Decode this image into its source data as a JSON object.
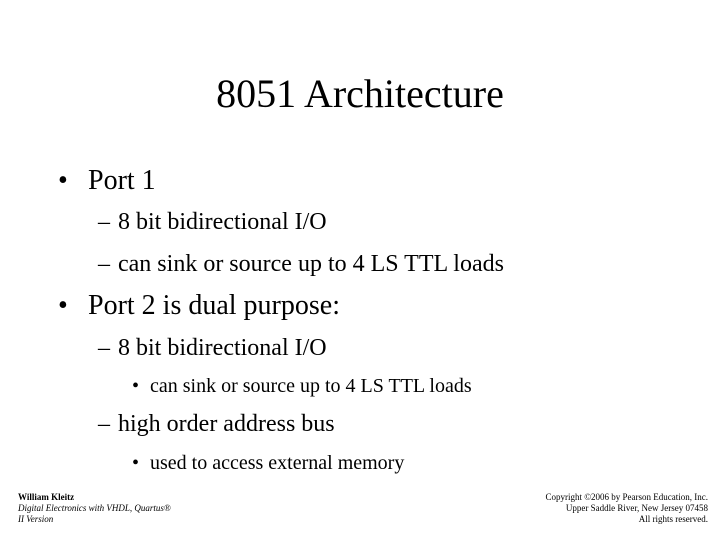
{
  "slide": {
    "title": "8051 Architecture",
    "bullets": [
      {
        "marker": "•",
        "text": "Port 1"
      },
      {
        "marker": "–",
        "text": "8 bit bidirectional I/O"
      },
      {
        "marker": "–",
        "text": "can sink or source up to 4 LS TTL loads"
      },
      {
        "marker": "•",
        "text": "Port 2 is dual purpose:"
      },
      {
        "marker": "–",
        "text": "8 bit bidirectional I/O"
      },
      {
        "marker": "•",
        "text": "can sink or source up to 4 LS TTL loads"
      },
      {
        "marker": "–",
        "text": "high order address bus"
      },
      {
        "marker": "•",
        "text": "used to access external memory"
      }
    ]
  },
  "footer": {
    "author": "William Kleitz",
    "book_line1": "Digital Electronics with VHDL, Quartus®",
    "book_line2": "II Version",
    "copyright_line1": "Copyright ©2006 by Pearson Education, Inc.",
    "copyright_line2": "Upper Saddle River, New Jersey 07458",
    "copyright_line3": "All rights reserved."
  }
}
